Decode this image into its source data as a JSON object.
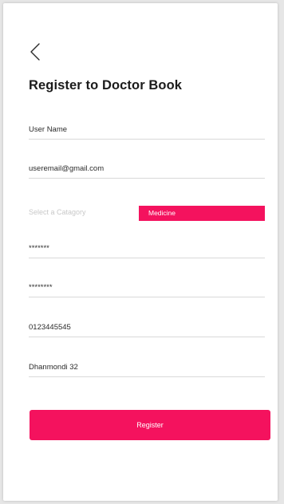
{
  "header": {
    "back_icon": "chevron-left-icon",
    "title": "Register to Doctor Book"
  },
  "form": {
    "username": {
      "value": "",
      "placeholder": "User Name"
    },
    "email": {
      "value": "",
      "placeholder": "useremail@gmail.com"
    },
    "category": {
      "label": "Select a Catagory",
      "selected": "Medicine"
    },
    "password": {
      "value": "*******"
    },
    "confirm_password": {
      "value": "********"
    },
    "phone": {
      "value": "0123445545"
    },
    "address": {
      "value": "Dhanmondi 32"
    },
    "register_label": "Register"
  },
  "colors": {
    "accent": "#f4125e",
    "text": "#1b1b1b",
    "placeholder_muted": "#c8c8c8",
    "divider": "#d9d9d9"
  }
}
